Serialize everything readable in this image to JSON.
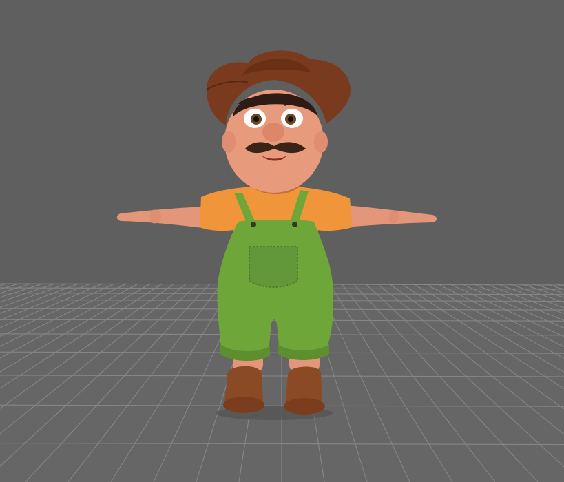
{
  "viewport": {
    "background_color": "#5f5f5f",
    "grid_color": "#7d7d7d",
    "grid_line_color": "#8a8a8a",
    "floor_color": "#6a6a6a"
  },
  "character": {
    "pose": "T-pose",
    "skin_color": "#e89a7c",
    "hat_color": "#7a3a1e",
    "shirt_color": "#f0953a",
    "overalls_color": "#6fa63a",
    "boots_color": "#8a4a26",
    "mustache_color": "#3a2418",
    "hair_color": "#2e1c14"
  }
}
